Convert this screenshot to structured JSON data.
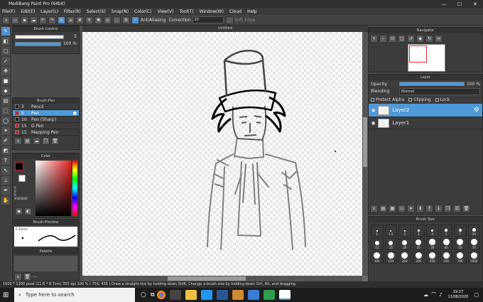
{
  "app": {
    "title": "MediBang Paint Pro (64bit)",
    "min": "—",
    "max": "☐",
    "close": "✕"
  },
  "menu": [
    "File(F)",
    "Edit(E)",
    "Layer(L)",
    "Filter(R)",
    "Select(S)",
    "Snap(N)",
    "Color(C)",
    "View(V)",
    "Tool(T)",
    "Window(W)",
    "Cloud",
    "Help"
  ],
  "toolbar": {
    "antialias_label": "AntiAliasing",
    "correction_label": "Correction",
    "correction_value": "20",
    "soft_edge_label": "Soft Edge"
  },
  "brush_control": {
    "title": "Brush Control",
    "size_value": "5",
    "opacity_value": "100 %"
  },
  "brush_panel": {
    "title": "Brush:Pen",
    "items": [
      {
        "size": "3",
        "name": "Pencil",
        "color": "#222222"
      },
      {
        "size": "5",
        "name": "Pen",
        "color": "#cc2222"
      },
      {
        "size": "10",
        "name": "Pen (Sharp)",
        "color": "#222222"
      },
      {
        "size": "15",
        "name": "G Pen",
        "color": "#cc2222"
      },
      {
        "size": "15",
        "name": "Mapping Pen",
        "color": "#cc2222"
      }
    ]
  },
  "color_panel": {
    "title": "Color",
    "r": "0",
    "g": "0",
    "b": "0",
    "hex": "#000000"
  },
  "brush_preview": {
    "title": "Brush Preview",
    "size_label": "0.35mm"
  },
  "palette": {
    "title": "Palette",
    "hint": "---"
  },
  "canvas": {
    "title": "Untitled"
  },
  "navigator": {
    "title": "Navigator"
  },
  "layer_panel": {
    "title": "Layer",
    "opacity_label": "Opacity",
    "opacity_value": "100 %",
    "opacity_fraction": 1.0,
    "blending_label": "Blending",
    "blending_value": "Normal",
    "protect_alpha": "Protect Alpha",
    "clipping": "Clipping",
    "lock": "Lock",
    "layers": [
      {
        "name": "Layer2",
        "selected": true
      },
      {
        "name": "Layer1",
        "selected": false
      }
    ]
  },
  "brush_size_panel": {
    "title": "Brush Size",
    "rows": [
      [
        "1",
        "1.5",
        "2",
        "3",
        "4",
        "5",
        "7",
        "10"
      ],
      [
        "13",
        "15",
        "20",
        "25",
        "30",
        "40",
        "50",
        "70"
      ],
      [
        "100",
        "150",
        "200",
        "300",
        "400",
        "500",
        "700",
        "1000"
      ]
    ]
  },
  "statusbar": {
    "text": "1600 * 1200 pixel   (11.6 * 8.7cm)   350 dpi   100 %   ( 754, 436 )   Draw a straight line by holding down Shift, Change a brush size by holding down Ctrl, Alt, and dragging"
  },
  "taskbar": {
    "search_placeholder": "Type here to search",
    "time": "19:27",
    "date": "11/08/2020"
  },
  "colors": {
    "accent": "#4f9ad8",
    "taskbar": "#1d1d1d"
  }
}
